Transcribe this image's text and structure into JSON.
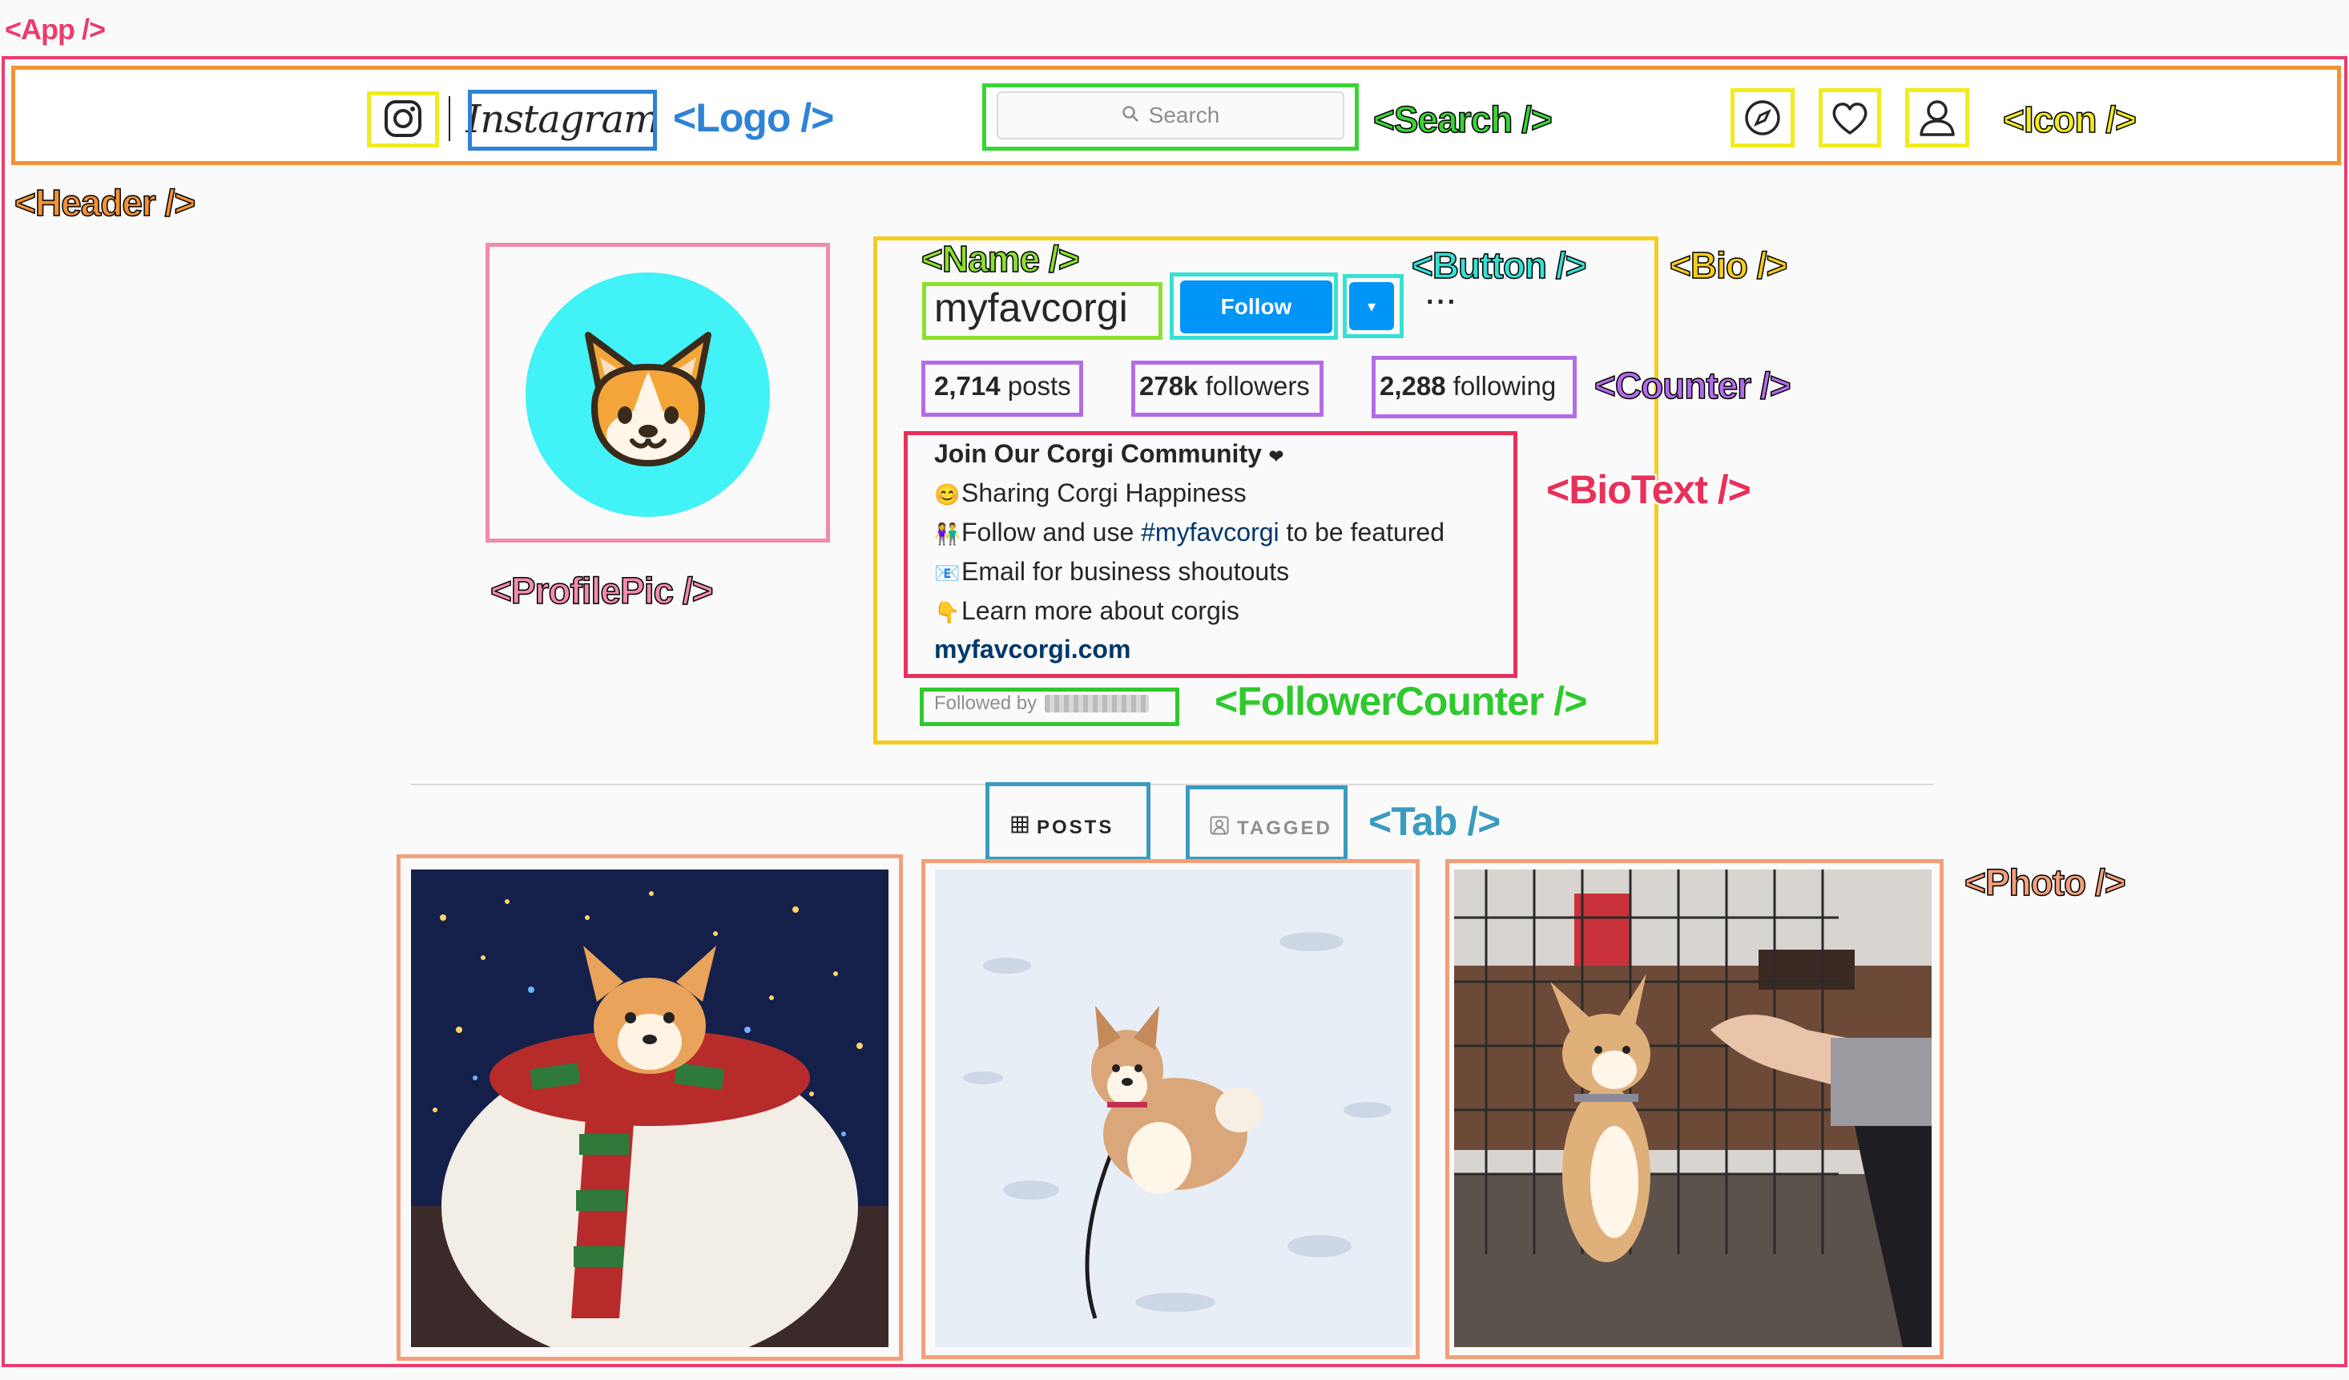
{
  "header": {
    "logo_text": "Instagram",
    "search_placeholder": "Search",
    "icons": [
      "instagram-glyph-icon",
      "compass-icon",
      "heart-icon",
      "user-icon"
    ]
  },
  "profile": {
    "username": "myfavcorgi",
    "follow_label": "Follow",
    "dropdown_glyph": "▾",
    "more_glyph": "···",
    "counters": {
      "posts_value": "2,714",
      "posts_label": "posts",
      "followers_value": "278k",
      "followers_label": "followers",
      "following_value": "2,288",
      "following_label": "following"
    },
    "bio": {
      "title": "Join Our Corgi Community",
      "title_heart": "❤",
      "line1_emoji": "😊",
      "line1": "Sharing Corgi Happiness",
      "line2_emoji": "👫",
      "line2_pre": "Follow and use ",
      "line2_hashtag": "#myfavcorgi",
      "line2_post": " to be featured",
      "line3_emoji": "📧",
      "line3": "Email for business shoutouts",
      "line4_emoji": "👇",
      "line4": "Learn more about corgis",
      "link": "myfavcorgi.com"
    },
    "followed_by_label": "Followed by"
  },
  "tabs": [
    {
      "label": "POSTS",
      "icon": "grid-icon",
      "active": true
    },
    {
      "label": "TAGGED",
      "icon": "tagged-icon",
      "active": false
    }
  ],
  "photos": [
    {
      "subject": "corgi in christmas scarf ornament"
    },
    {
      "subject": "corgi in snow"
    },
    {
      "subject": "corgi standing in kennel"
    }
  ],
  "annotations": {
    "app": "<App />",
    "header": "<Header />",
    "logo": "<Logo />",
    "search": "<Search />",
    "icon": "<Icon />",
    "name": "<Name />",
    "button": "<Button />",
    "bio": "<Bio />",
    "counter": "<Counter />",
    "biotext": "<BioText />",
    "profilepic": "<ProfilePic />",
    "followercounter": "<FollowerCounter />",
    "tab": "<Tab />",
    "photo": "<Photo />"
  },
  "colors": {
    "app": "#ea3d6e",
    "header": "#f29233",
    "logo": "#2f83d6",
    "search": "#39d436",
    "icon": "#f2eb1d",
    "name": "#8be02f",
    "button": "#37e0d5",
    "bio": "#f5cc1e",
    "counter": "#b36ce8",
    "biotext": "#e8305a",
    "profilepic": "#f28ab0",
    "followercounter": "#2fc92f",
    "tab": "#3b9bbf",
    "photo": "#f2a07a",
    "follow_button": "#0095f6",
    "avatar_bg": "#41f2f6"
  }
}
